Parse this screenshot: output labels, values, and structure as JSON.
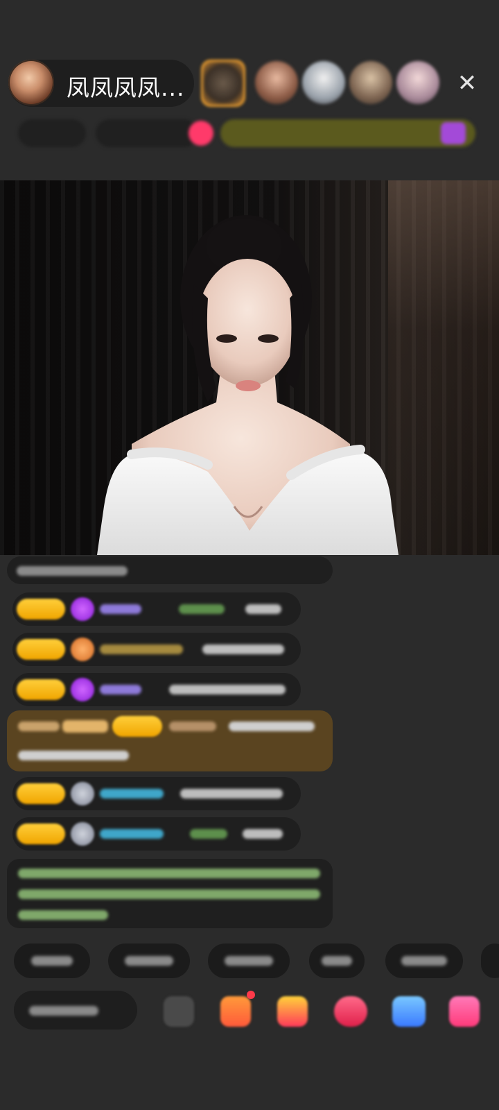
{
  "header": {
    "host_name": "凤凤凤凤...",
    "close_symbol": "✕"
  },
  "colors": {
    "background": "#2b2b2b",
    "level_badge": "#f5b214",
    "highlight_message_bg": "#5a4420",
    "accent_pink": "#ff3a6a"
  },
  "icons": {
    "close": "close-icon",
    "gift": "gift-icon",
    "emoji": "emoji-icon"
  }
}
